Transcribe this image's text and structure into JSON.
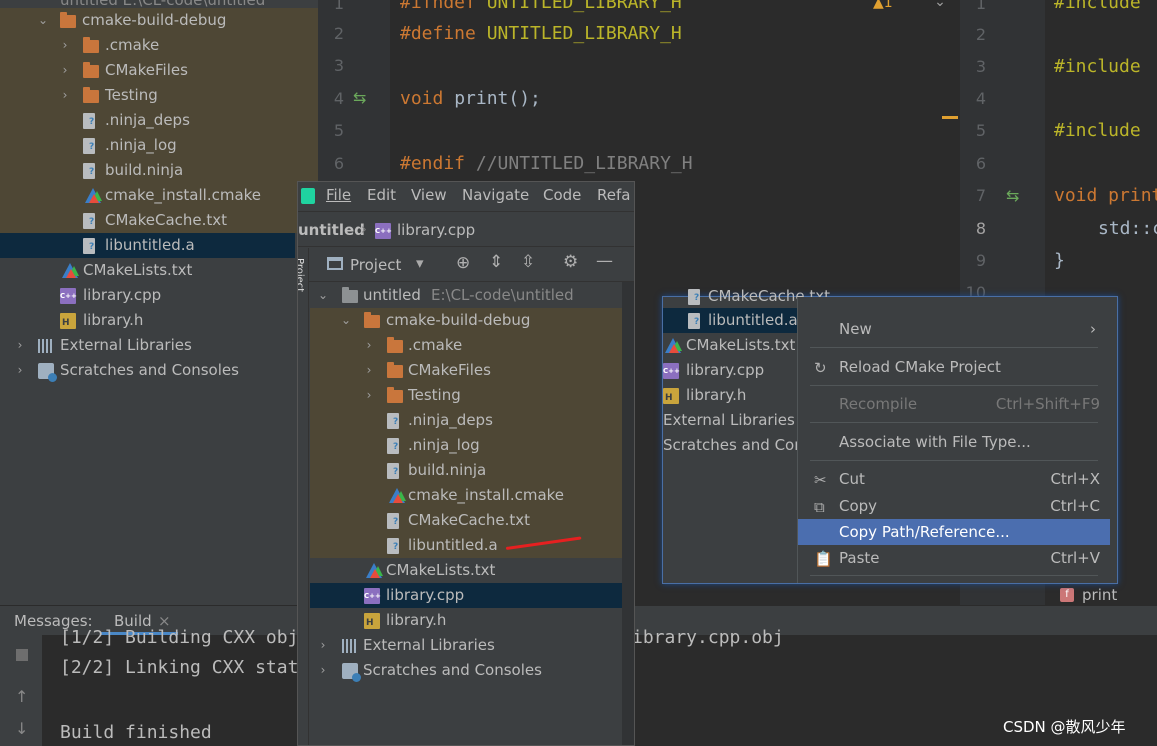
{
  "bg_tree": {
    "top_cut": "untitled  E:\\CL-code\\untitled",
    "items": [
      {
        "label": "cmake-build-debug"
      },
      {
        "label": ".cmake"
      },
      {
        "label": "CMakeFiles"
      },
      {
        "label": "Testing"
      },
      {
        "label": ".ninja_deps"
      },
      {
        "label": ".ninja_log"
      },
      {
        "label": "build.ninja"
      },
      {
        "label": "cmake_install.cmake"
      },
      {
        "label": "CMakeCache.txt"
      },
      {
        "label": "libuntitled.a"
      },
      {
        "label": "CMakeLists.txt"
      },
      {
        "label": "library.cpp"
      },
      {
        "label": "library.h"
      },
      {
        "label": "External Libraries"
      },
      {
        "label": "Scratches and Consoles"
      }
    ]
  },
  "editor_left": {
    "line_numbers": [
      "1",
      "2",
      "3",
      "4",
      "5",
      "6"
    ],
    "lines": [
      {
        "kw": "#ifndef",
        "rest": " UNTITLED_LIBRARY_H"
      },
      {
        "kw": "#define",
        "rest": " UNTITLED_LIBRARY_H"
      },
      {
        "kw": "",
        "rest": ""
      },
      {
        "kw": "void",
        "rest": " print();"
      },
      {
        "kw": "",
        "rest": ""
      },
      {
        "kw": "#endif",
        "rest": " //UNTITLED_LIBRARY_H"
      }
    ],
    "warning": "▲1"
  },
  "editor_right": {
    "line_numbers": [
      "1",
      "2",
      "3",
      "4",
      "5",
      "6",
      "7",
      "8",
      "9",
      "10"
    ],
    "lines": [
      "#include",
      "",
      "#include",
      "",
      "#include",
      "",
      "void print",
      "std::c",
      "}"
    ]
  },
  "fg_window": {
    "menu": [
      "File",
      "Edit",
      "View",
      "Navigate",
      "Code",
      "Refa"
    ],
    "breadcrumb": {
      "project": "untitled",
      "file": "library.cpp"
    },
    "project_dropdown": "Project",
    "side_tab": "Project",
    "root": {
      "label": "untitled",
      "path": "E:\\CL-code\\untitled"
    },
    "items": [
      {
        "label": "cmake-build-debug"
      },
      {
        "label": ".cmake"
      },
      {
        "label": "CMakeFiles"
      },
      {
        "label": "Testing"
      },
      {
        "label": ".ninja_deps"
      },
      {
        "label": ".ninja_log"
      },
      {
        "label": "build.ninja"
      },
      {
        "label": "cmake_install.cmake"
      },
      {
        "label": "CMakeCache.txt"
      },
      {
        "label": "libuntitled.a"
      },
      {
        "label": "CMakeLists.txt"
      },
      {
        "label": "library.cpp"
      },
      {
        "label": "library.h"
      },
      {
        "label": "External Libraries"
      },
      {
        "label": "Scratches and Consoles"
      }
    ]
  },
  "ctx_tree": {
    "items": [
      "CMakeCache.txt",
      "libuntitled.a",
      "CMakeLists.txt",
      "library.cpp",
      "library.h",
      "External Libraries",
      "Scratches and Con"
    ]
  },
  "context_menu": {
    "new": "New",
    "reload": "Reload CMake Project",
    "recompile": "Recompile",
    "recompile_sc": "Ctrl+Shift+F9",
    "associate": "Associate with File Type...",
    "cut": "Cut",
    "cut_sc": "Ctrl+X",
    "copy": "Copy",
    "copy_sc": "Ctrl+C",
    "copy_path": "Copy Path/Reference...",
    "paste": "Paste",
    "paste_sc": "Ctrl+V"
  },
  "build_panel": {
    "messages_label": "Messages:",
    "tab": "Build",
    "lines": [
      "[1/2] Building CXX obj",
      "[2/2] Linking CXX stat",
      "",
      "Build finished"
    ],
    "right_cut": "ibrary.cpp.obj",
    "print_tag": "print"
  },
  "watermark": "CSDN @散风少年",
  "colors": {
    "selection": "#0d293e",
    "highlight": "#4b6eaf",
    "folder": "#c9763c",
    "keyword": "#cc7832"
  }
}
